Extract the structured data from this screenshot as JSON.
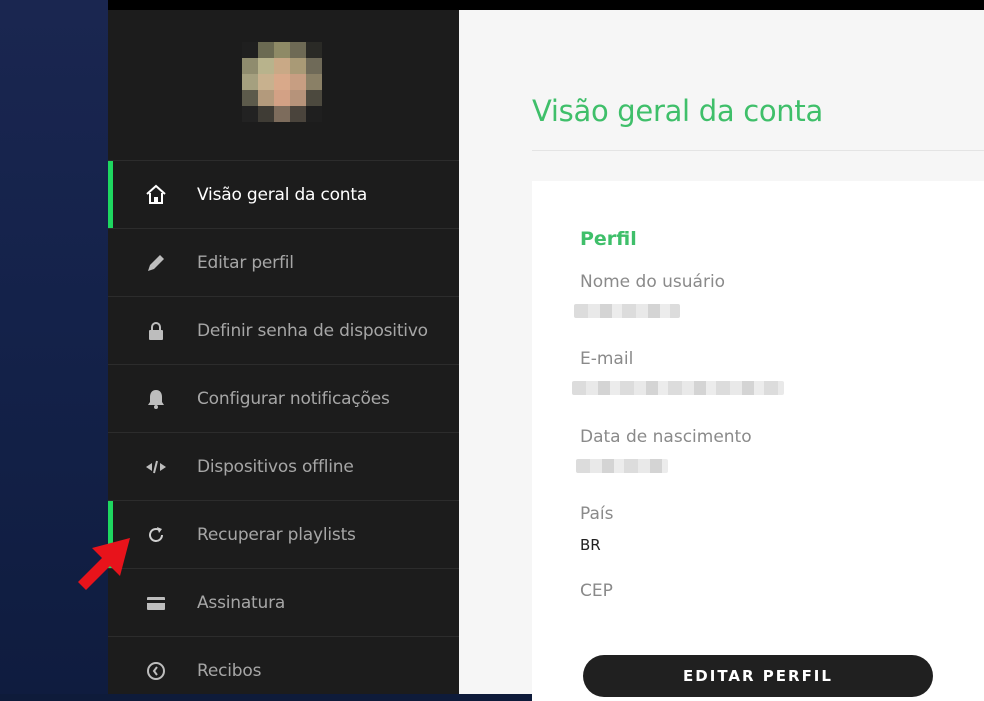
{
  "sidebar": {
    "items": [
      {
        "label": "Visão geral da conta",
        "icon": "home-icon",
        "active": true
      },
      {
        "label": "Editar perfil",
        "icon": "pencil-icon"
      },
      {
        "label": "Definir senha de dispositivo",
        "icon": "lock-icon"
      },
      {
        "label": "Configurar notificações",
        "icon": "bell-icon"
      },
      {
        "label": "Dispositivos offline",
        "icon": "devices-icon"
      },
      {
        "label": "Recuperar playlists",
        "icon": "refresh-icon",
        "highlighted": true
      },
      {
        "label": "Assinatura",
        "icon": "card-icon"
      },
      {
        "label": "Recibos",
        "icon": "clock-icon"
      }
    ]
  },
  "main": {
    "title": "Visão geral da conta",
    "profile": {
      "section_title": "Perfil",
      "username_label": "Nome do usuário",
      "email_label": "E-mail",
      "birthdate_label": "Data de nascimento",
      "country_label": "País",
      "country_value": "BR",
      "zip_label": "CEP",
      "edit_button": "EDITAR PERFIL"
    }
  },
  "colors": {
    "accent": "#1ed760",
    "title_green": "#3fbf6a",
    "arrow": "#e8131b",
    "sidebar": "#1c1c1c"
  }
}
